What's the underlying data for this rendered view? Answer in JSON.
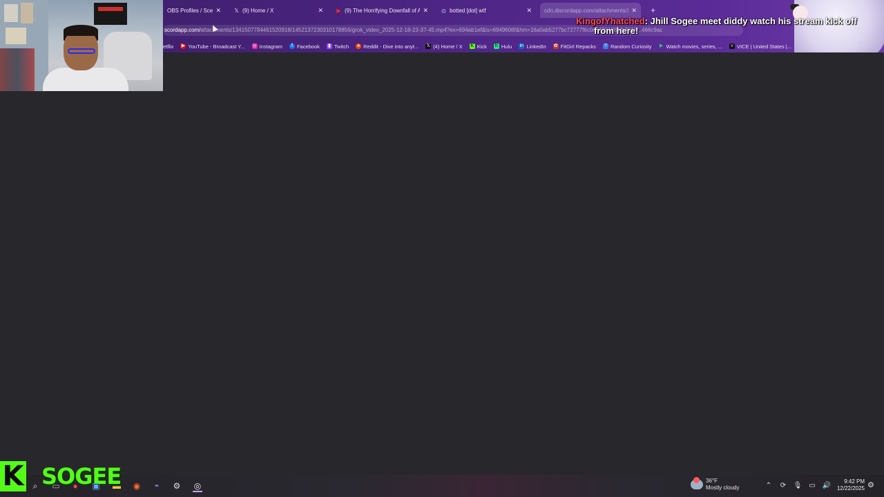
{
  "tabs": [
    {
      "title": "OBS Profiles / Scen",
      "icon": "obs-icon",
      "active": false
    },
    {
      "title": "(9) Home / X",
      "icon": "x-icon",
      "active": false
    },
    {
      "title": "(9) The Horrifying Downfall of A",
      "icon": "youtube-icon",
      "active": false
    },
    {
      "title": "botted [dot] wtf",
      "icon": "globe-icon",
      "active": false
    },
    {
      "title": "cdn.discordapp.com/attachments/1",
      "icon": "discord-icon",
      "active": true
    }
  ],
  "address": {
    "domain": "scordapp.com/",
    "path": "attachments/1341507784461520918/1452137230310178856/grok_video_2025-12-18-23-37-45.mp4?ex=694ab1ef&is=6949606f&hm=16a0ab5277bc72777f6c0cd4201861fb7617...466c9ac"
  },
  "bookmarks": [
    {
      "label": "etflix",
      "icon": "netflix-icon",
      "color": "#e50914"
    },
    {
      "label": "YouTube - Broadcast Y...",
      "icon": "youtube-icon",
      "color": "#ff0000"
    },
    {
      "label": "Instagram",
      "icon": "instagram-icon",
      "color": "#d6249f"
    },
    {
      "label": "Facebook",
      "icon": "facebook-icon",
      "color": "#1877f2"
    },
    {
      "label": "Twitch",
      "icon": "twitch-icon",
      "color": "#9146ff"
    },
    {
      "label": "Reddit - Dive into anyt...",
      "icon": "reddit-icon",
      "color": "#ff4500"
    },
    {
      "label": "(4) Home / X",
      "icon": "x-icon",
      "color": "#111111"
    },
    {
      "label": "Kick",
      "icon": "kick-icon",
      "color": "#53fc18"
    },
    {
      "label": "Hulu",
      "icon": "hulu-icon",
      "color": "#1ce783"
    },
    {
      "label": "LinkedIn",
      "icon": "linkedin-icon",
      "color": "#0a66c2"
    },
    {
      "label": "FitGirl Repacks",
      "icon": "fitgirl-icon",
      "color": "#c0392b"
    },
    {
      "label": "Random Curiosity",
      "icon": "random-curiosity-icon",
      "color": "#3d7bd9"
    },
    {
      "label": "Watch movies, series, ...",
      "icon": "play-icon",
      "color": "#2ecc71"
    },
    {
      "label": "VICE | United States |...",
      "icon": "vice-icon",
      "color": "#111111"
    }
  ],
  "chat": {
    "username": "KingofYhatched",
    "separator": ":",
    "message_line1": "Jhill Sogee meet diddy watch his stream kick off",
    "message_line2": "from here!"
  },
  "streamer": {
    "platform_letter": "K",
    "name": "SOGEE"
  },
  "taskbar": {
    "weather_temp": "36°F",
    "weather_desc": "Mostly cloudy",
    "time": "9:42 PM",
    "date": "12/22/2025"
  }
}
